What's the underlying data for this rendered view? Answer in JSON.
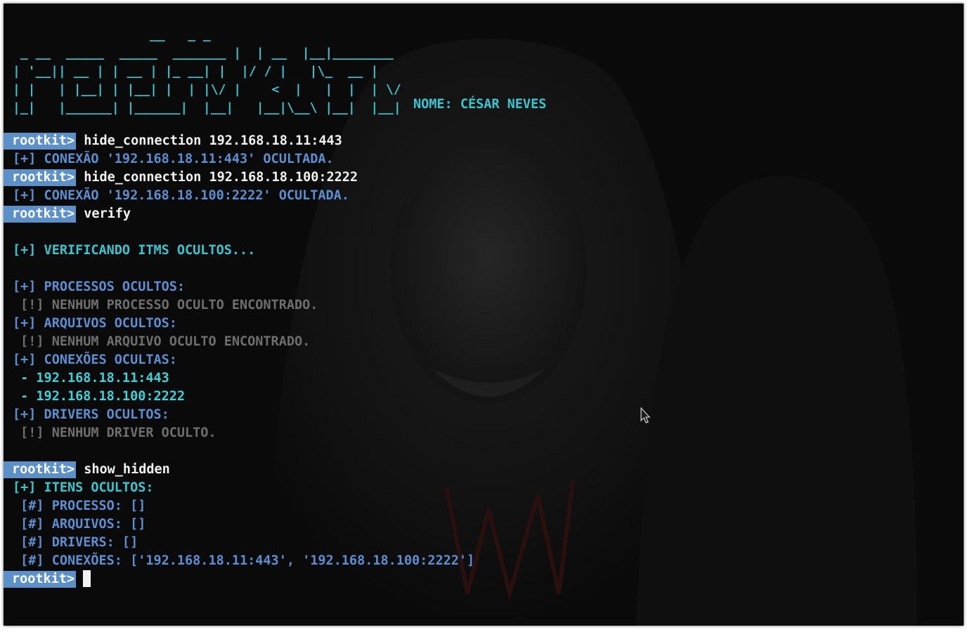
{
  "banner": {
    "ascii": "                  __   _ _\n _ __  _____  _____  _______ |  | __  |__|________\n| '__|| __ | | __ | |_ __| |  |/ / |   |\\_  __ |\n| |   | |__| | |__| |  | |\\/ |    <  |   |  |  | \\/\n|_|   |______| |______|  |__|   |__|\\__\\ |__|  |__|",
    "nome": "NOME: CÉSAR NEVES"
  },
  "prompt_label": "rootkit>",
  "lines": [
    {
      "kind": "prompt",
      "text": "hide_connection 192.168.18.11:443"
    },
    {
      "kind": "blue",
      "text": "[+] CONEXÃO '192.168.18.11:443' OCULTADA."
    },
    {
      "kind": "prompt",
      "text": "hide_connection 192.168.18.100:2222"
    },
    {
      "kind": "blue",
      "text": "[+] CONEXÃO '192.168.18.100:2222' OCULTADA."
    },
    {
      "kind": "prompt",
      "text": "verify"
    },
    {
      "kind": "blank",
      "text": ""
    },
    {
      "kind": "cyan",
      "text": "[+] VERIFICANDO ITMS OCULTOS..."
    },
    {
      "kind": "blank",
      "text": ""
    },
    {
      "kind": "blue",
      "text": "[+] PROCESSOS OCULTOS:"
    },
    {
      "kind": "gray",
      "text": " [!] NENHUM PROCESSO OCULTO ENCONTRADO."
    },
    {
      "kind": "blue",
      "text": "[+] ARQUIVOS OCULTOS:"
    },
    {
      "kind": "gray",
      "text": " [!] NENHUM ARQUIVO OCULTO ENCONTRADO."
    },
    {
      "kind": "blue",
      "text": "[+] CONEXÕES OCULTAS:"
    },
    {
      "kind": "cyanbright",
      "text": " - 192.168.18.11:443"
    },
    {
      "kind": "cyanbright",
      "text": " - 192.168.18.100:2222"
    },
    {
      "kind": "blue",
      "text": "[+] DRIVERS OCULTOS:"
    },
    {
      "kind": "gray",
      "text": " [!] NENHUM DRIVER OCULTO."
    },
    {
      "kind": "blank",
      "text": ""
    },
    {
      "kind": "prompt",
      "text": "show_hidden"
    },
    {
      "kind": "cyan",
      "text": "[+] ITENS OCULTOS:"
    },
    {
      "kind": "blue",
      "text": " [#] PROCESSO: []"
    },
    {
      "kind": "blue",
      "text": " [#] ARQUIVOS: []"
    },
    {
      "kind": "blue",
      "text": " [#] DRIVERS: []"
    },
    {
      "kind": "blue",
      "text": " [#] CONEXÕES: ['192.168.18.11:443', '192.168.18.100:2222']"
    },
    {
      "kind": "input",
      "text": ""
    }
  ],
  "colors": {
    "background": "#0a0a0a",
    "prompt_bg": "#5b90c9",
    "blue_text": "#5b8fd2",
    "cyan_text": "#39c5cf",
    "gray_text": "#6e6e6e",
    "command_text": "#f2f2f2"
  }
}
